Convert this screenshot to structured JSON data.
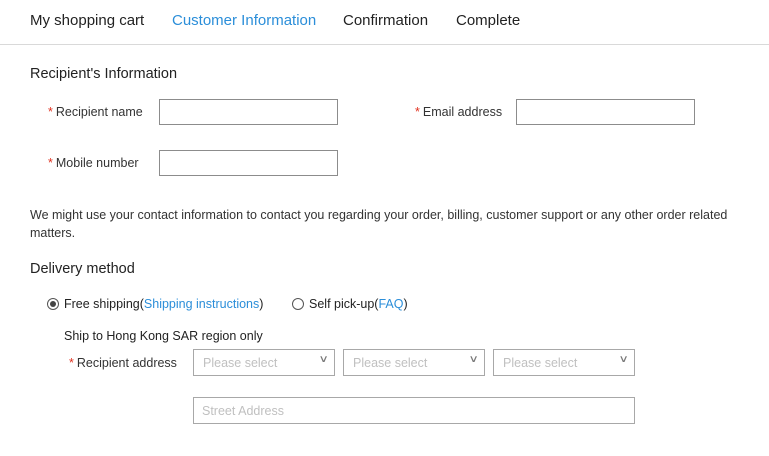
{
  "steps": [
    {
      "label": "My shopping cart"
    },
    {
      "label": "Customer Information",
      "active": true
    },
    {
      "label": "Confirmation"
    },
    {
      "label": "Complete"
    }
  ],
  "recipient_section": {
    "title": "Recipient's Information",
    "required_mark": "*",
    "name_label": "Recipient name",
    "name_value": "",
    "email_label": "Email address",
    "email_value": "",
    "mobile_label": "Mobile number",
    "mobile_value": "",
    "contact_note": "We might use your contact information to contact you regarding your order, billing, customer support or any other order related matters."
  },
  "delivery_section": {
    "title": "Delivery method",
    "options": [
      {
        "label": "Free shipping(",
        "link": "Shipping instructions",
        "suffix": ")",
        "selected": true
      },
      {
        "label": "Self pick-up(",
        "link": "FAQ",
        "suffix": ")",
        "selected": false
      }
    ],
    "ship_note": "Ship to Hong Kong SAR region only",
    "address_label": "Recipient address",
    "selects": [
      {
        "placeholder": "Please select"
      },
      {
        "placeholder": "Please select"
      },
      {
        "placeholder": "Please select"
      }
    ],
    "street_placeholder": "Street Address"
  },
  "colors": {
    "accent": "#2b8ed9",
    "required": "#e0301e"
  },
  "icons": {
    "select_chevron": "chevron-down-icon"
  }
}
